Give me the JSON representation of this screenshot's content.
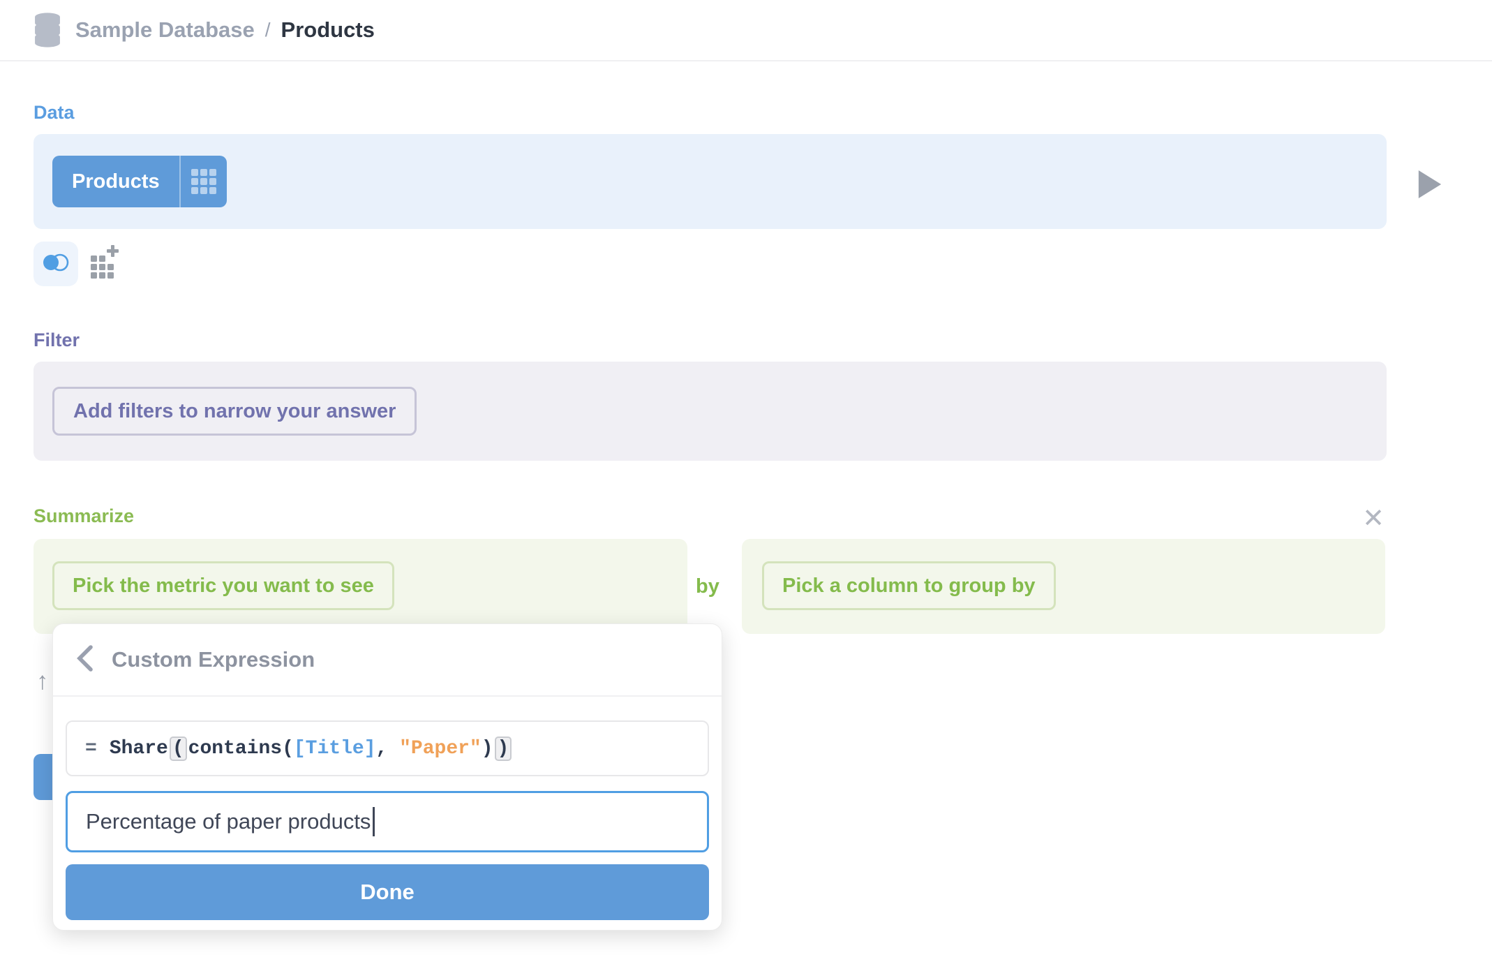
{
  "header": {
    "database_crumb": "Sample Database",
    "separator": "/",
    "page_title": "Products"
  },
  "data_section": {
    "label": "Data",
    "table_name": "Products"
  },
  "filter_section": {
    "label": "Filter",
    "add_button": "Add filters to narrow your answer"
  },
  "summarize_section": {
    "label": "Summarize",
    "pick_metric_button": "Pick the metric you want to see",
    "by_label": "by",
    "pick_column_button": "Pick a column to group by"
  },
  "popup": {
    "title": "Custom Expression",
    "expression": {
      "equals": "=",
      "tokens": [
        {
          "text": "Share",
          "type": "function"
        },
        {
          "text": "(",
          "type": "paren-match"
        },
        {
          "text": "contains(",
          "type": "function"
        },
        {
          "text": "[Title]",
          "type": "field"
        },
        {
          "text": ", ",
          "type": "plain"
        },
        {
          "text": "\"Paper\"",
          "type": "string"
        },
        {
          "text": ")",
          "type": "plain"
        },
        {
          "text": ")",
          "type": "paren-match"
        }
      ]
    },
    "name_input_value": "Percentage of paper products",
    "done_button": "Done"
  },
  "glyphs": {
    "close_icon": "✕",
    "sort_arrow_icon": "↑"
  },
  "colors": {
    "brand_blue": "#509ee3",
    "button_blue": "#5f9bd9",
    "filter_purple": "#7172ad",
    "summarize_green": "#84bb4c",
    "expression_string_orange": "#f0a158",
    "expression_field_blue": "#5a9ee0",
    "text_dark": "#2e3642",
    "muted_gray": "#9aa2b1"
  }
}
